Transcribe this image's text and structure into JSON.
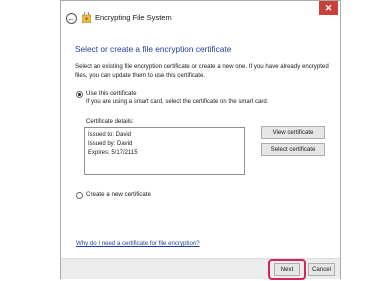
{
  "window": {
    "title": "Encrypting File System",
    "close_glyph": "✕",
    "back_glyph": "←"
  },
  "main": {
    "heading": "Select or create a file encryption certificate",
    "description": "Select an existing file encryption certificate or create a new one. If you have already encrypted files, you can update them to use this certificate.",
    "use_certificate_label": "Use this certificate",
    "use_certificate_checked": true,
    "smartcard_note": "If you are using a smart card, select the certificate on the smart card.",
    "details_label": "Certificate details:",
    "details": {
      "issued_to": "Issued to: David",
      "issued_by": "Issued by: David",
      "expires": "Expires: 5/17/2115"
    },
    "view_certificate_label": "View certificate",
    "select_certificate_label": "Select certificate",
    "create_new_label": "Create a new certificate",
    "create_new_checked": false,
    "help_link": "Why do I need a certificate for file encryption?"
  },
  "footer": {
    "next_label": "Next",
    "cancel_label": "Cancel"
  },
  "colors": {
    "heading": "#1f3f9e",
    "close_button": "#c7413a",
    "highlight": "#d1265a"
  }
}
